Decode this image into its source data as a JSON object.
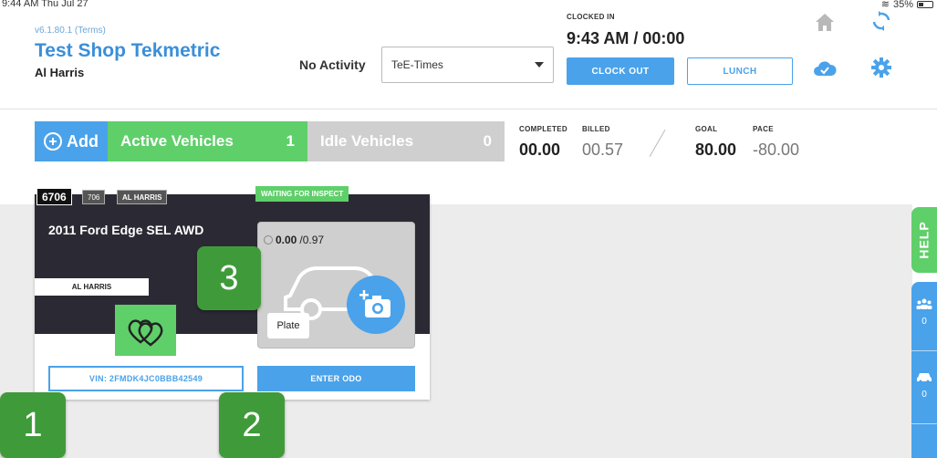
{
  "status_bar": {
    "time": "9:44 AM  Thu Jul 27",
    "battery": "35%"
  },
  "header": {
    "version": "v6.1.80.1 (Terms)",
    "shop_name": "Test Shop Tekmetric",
    "user_name": "Al Harris",
    "activity_label": "No Activity",
    "activity_select_value": "TeE-Times",
    "clocked_in_label": "CLOCKED IN",
    "clock_time": "9:43 AM / 00:00",
    "clock_out_label": "CLOCK OUT",
    "lunch_label": "LUNCH",
    "icons": [
      "home-icon",
      "sync-icon",
      "cloud-icon",
      "gear-icon"
    ]
  },
  "toolbar": {
    "add_label": "Add",
    "active_label": "Active Vehicles",
    "active_count": "1",
    "idle_label": "Idle Vehicles",
    "idle_count": "0"
  },
  "stats": {
    "completed_label": "COMPLETED",
    "completed_value": "00.00",
    "billed_label": "BILLED",
    "billed_value": "00.57",
    "goal_label": "GOAL",
    "goal_value": "80.00",
    "pace_label": "PACE",
    "pace_value": "-80.00"
  },
  "vehicle_card": {
    "ro_number": "6706",
    "small_tag": "706",
    "tech_tag": "AL HARRIS",
    "status": "WAITING FOR INSPECT",
    "vehicle": "2011 Ford Edge SEL AWD",
    "technician": "AL HARRIS",
    "hours": "0.00",
    "hours_total": "/0.97",
    "plate_label": "Plate",
    "vin_label": "VIN: 2FMDK4JC0BBB42549",
    "odo_label": "ENTER ODO"
  },
  "callouts": [
    "1",
    "2",
    "3"
  ],
  "sidebar": {
    "help_label": "HELP",
    "items": [
      {
        "icon": "people-icon",
        "count": "0"
      },
      {
        "icon": "car-icon",
        "count": "0"
      }
    ]
  },
  "colors": {
    "blue": "#4aa2ea",
    "green": "#5fcf6a",
    "callout_green": "#3f9b3a",
    "dark": "#2b2a34"
  }
}
